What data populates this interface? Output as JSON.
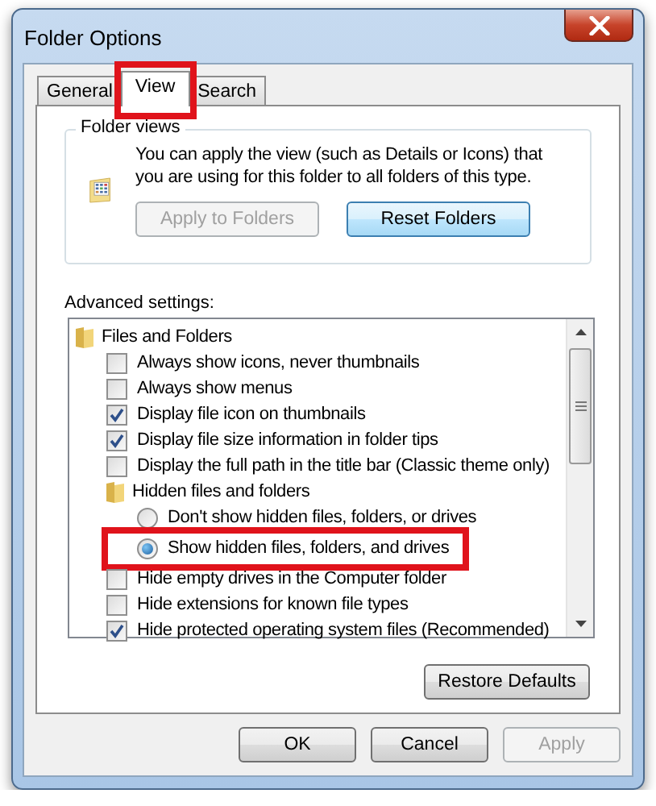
{
  "window": {
    "title": "Folder Options"
  },
  "tabs": [
    {
      "label": "General",
      "selected": false,
      "highlighted": false
    },
    {
      "label": "View",
      "selected": true,
      "highlighted": true
    },
    {
      "label": "Search",
      "selected": false,
      "highlighted": false
    }
  ],
  "folder_views": {
    "title": "Folder views",
    "description": "You can apply the view (such as Details or Icons) that you are using for this folder to all folders of this type.",
    "buttons": [
      {
        "label": "Apply to Folders",
        "disabled": true,
        "focused": false
      },
      {
        "label": "Reset Folders",
        "disabled": false,
        "focused": true
      }
    ]
  },
  "advanced": {
    "label": "Advanced settings:",
    "items": [
      {
        "kind": "group",
        "label": "Files and Folders",
        "children": [
          {
            "kind": "checkbox",
            "label": "Always show icons, never thumbnails",
            "checked": false
          },
          {
            "kind": "checkbox",
            "label": "Always show menus",
            "checked": false
          },
          {
            "kind": "checkbox",
            "label": "Display file icon on thumbnails",
            "checked": true
          },
          {
            "kind": "checkbox",
            "label": "Display file size information in folder tips",
            "checked": true
          },
          {
            "kind": "checkbox",
            "label": "Display the full path in the title bar (Classic theme only)",
            "checked": false
          },
          {
            "kind": "group",
            "label": "Hidden files and folders",
            "children": [
              {
                "kind": "radio",
                "label": "Don't show hidden files, folders, or drives",
                "selected": false,
                "highlighted": false
              },
              {
                "kind": "radio",
                "label": "Show hidden files, folders, and drives",
                "selected": true,
                "highlighted": true
              }
            ]
          },
          {
            "kind": "checkbox",
            "label": "Hide empty drives in the Computer folder",
            "checked": false
          },
          {
            "kind": "checkbox",
            "label": "Hide extensions for known file types",
            "checked": false
          },
          {
            "kind": "checkbox",
            "label": "Hide protected operating system files (Recommended)",
            "checked": true
          }
        ]
      }
    ]
  },
  "restore_button": {
    "label": "Restore Defaults",
    "disabled": false
  },
  "buttons": [
    {
      "label": "OK",
      "disabled": false
    },
    {
      "label": "Cancel",
      "disabled": false
    },
    {
      "label": "Apply",
      "disabled": true
    }
  ]
}
